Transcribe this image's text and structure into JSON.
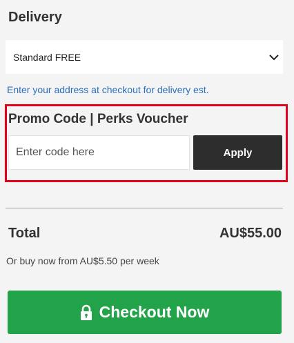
{
  "delivery": {
    "title": "Delivery",
    "selected_option": "Standard FREE",
    "chevron_icon": "chevron-down-icon",
    "note": "Enter your address at checkout for delivery est."
  },
  "promo": {
    "title": "Promo Code | Perks Voucher",
    "input_value": "",
    "input_placeholder": "Enter code here",
    "apply_label": "Apply",
    "highlight_color": "#e4001c"
  },
  "summary": {
    "total_label": "Total",
    "total_amount": "AU$55.00",
    "installment_text": "Or buy now from AU$5.50 per week"
  },
  "checkout": {
    "label": "Checkout Now",
    "icon": "lock-icon",
    "color": "#22a34a"
  }
}
